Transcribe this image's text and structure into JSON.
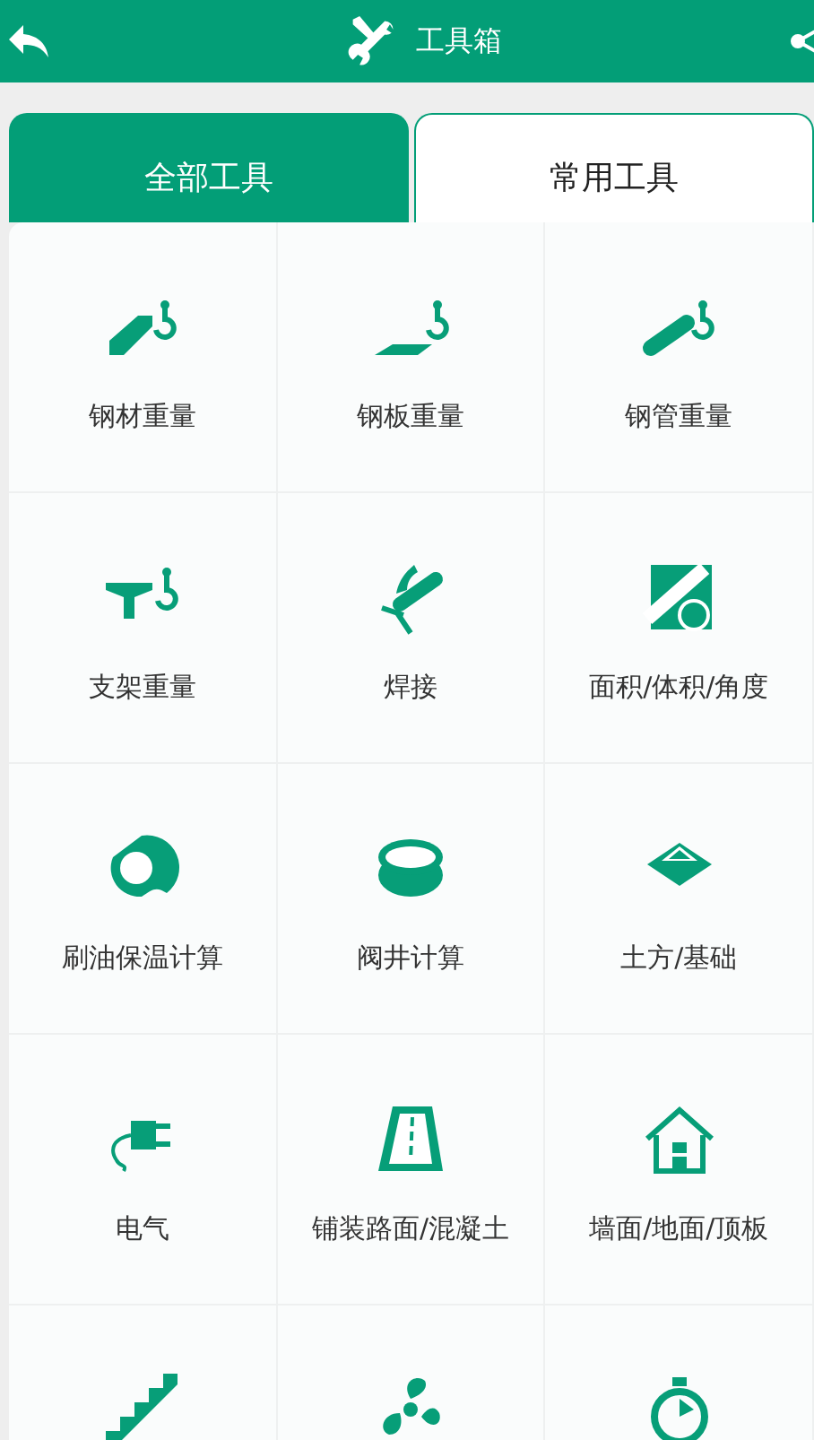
{
  "header": {
    "title": "工具箱"
  },
  "tabs": [
    {
      "label": "全部工具",
      "selected": true
    },
    {
      "label": "常用工具",
      "selected": false
    }
  ],
  "tools": [
    {
      "kind": "labeled",
      "label": "钢材重量"
    },
    {
      "kind": "labeled",
      "label": "钢板重量"
    },
    {
      "kind": "labeled",
      "label": "钢管重量"
    },
    {
      "kind": "labeled",
      "label": "支架重量"
    },
    {
      "kind": "labeled",
      "label": "焊接"
    },
    {
      "kind": "labeled",
      "label": "面积/体积/角度"
    },
    {
      "kind": "labeled",
      "label": "刷油保温计算"
    },
    {
      "kind": "labeled",
      "label": "阀井计算"
    },
    {
      "kind": "labeled",
      "label": "土方/基础"
    },
    {
      "kind": "labeled",
      "label": "电气"
    },
    {
      "kind": "labeled",
      "label": "铺装路面/混凝土"
    },
    {
      "kind": "labeled",
      "label": "墙面/地面/顶板"
    },
    {
      "kind": "icon_only"
    },
    {
      "kind": "icon_only"
    },
    {
      "kind": "icon_only"
    }
  ]
}
